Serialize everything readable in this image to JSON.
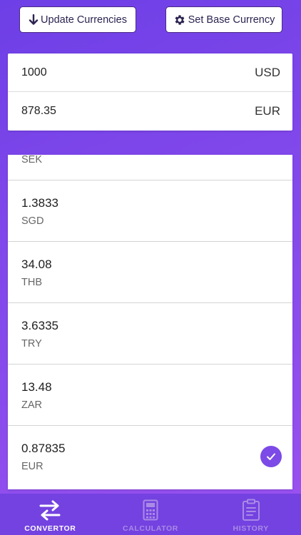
{
  "toolbar": {
    "update_label": "Update Currencies",
    "base_label": "Set Base Currency"
  },
  "converter": {
    "from": {
      "amount": "1000",
      "code": "USD"
    },
    "to": {
      "amount": "878.35",
      "code": "EUR"
    }
  },
  "rates": {
    "partial_code": "SEK",
    "items": [
      {
        "value": "1.3833",
        "code": "SGD"
      },
      {
        "value": "34.08",
        "code": "THB"
      },
      {
        "value": "3.6335",
        "code": "TRY"
      },
      {
        "value": "13.48",
        "code": "ZAR"
      },
      {
        "value": "0.87835",
        "code": "EUR",
        "selected": true
      }
    ]
  },
  "tabs": [
    {
      "label": "CONVERTOR",
      "icon": "swap-arrows-icon",
      "active": true
    },
    {
      "label": "CALCULATOR",
      "icon": "calculator-icon",
      "active": false
    },
    {
      "label": "HISTORY",
      "icon": "clipboard-icon",
      "active": false
    }
  ],
  "colors": {
    "accent": "#7c4ae6",
    "tab_bar": "#7442e0",
    "tab_inactive": "#a98ae6"
  }
}
